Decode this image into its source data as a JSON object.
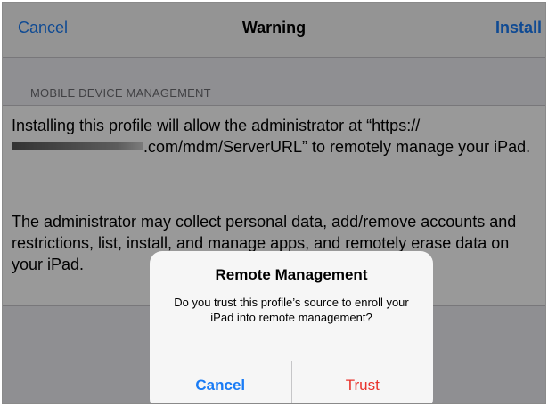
{
  "navbar": {
    "cancel_label": "Cancel",
    "title": "Warning",
    "install_label": "Install"
  },
  "section": {
    "header": "MOBILE DEVICE MANAGEMENT"
  },
  "body": {
    "para1_start": "Installing this profile will allow the administrator at “https://",
    "para1_url_suffix": ".com/mdm/ServerURL” to remotely manage your iPad.",
    "para2": "The administrator may collect personal data, add/remove accounts and restrictions, list, install, and manage apps, and remotely erase data on your iPad."
  },
  "alert": {
    "title": "Remote Management",
    "message": "Do you trust this profile’s source to enroll your iPad into remote management?",
    "cancel_label": "Cancel",
    "trust_label": "Trust"
  },
  "colors": {
    "accent": "#1a7cf5",
    "destructive": "#e9322c",
    "dim_overlay": "rgba(0,0,0,0.4)"
  }
}
